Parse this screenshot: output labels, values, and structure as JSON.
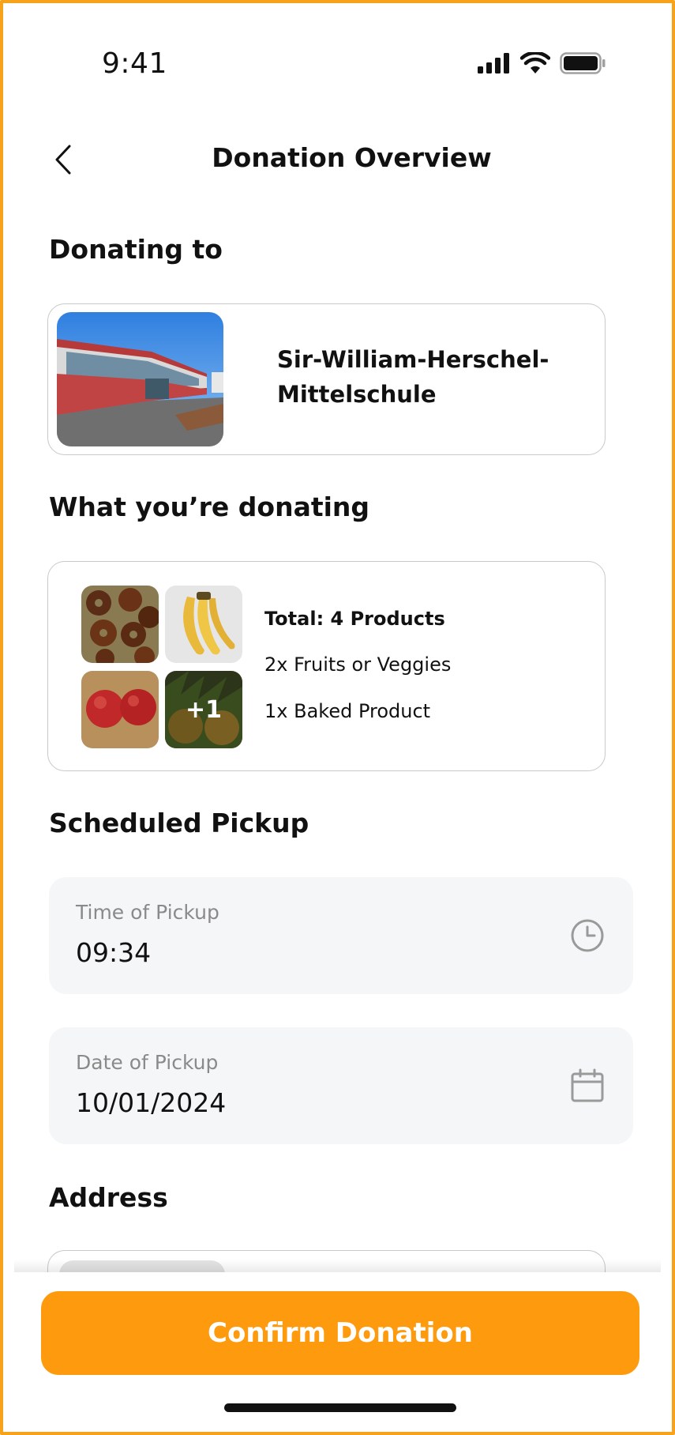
{
  "status_bar": {
    "time": "9:41"
  },
  "header": {
    "title": "Donation Overview"
  },
  "recipient": {
    "heading": "Donating to",
    "name": "Sir-William-Herschel-Mittelschule"
  },
  "donation": {
    "heading": "What you’re donating",
    "more_badge": "+1",
    "total": "Total: 4 Products",
    "lines": [
      "2x Fruits or Veggies",
      "1x Baked Product"
    ]
  },
  "pickup": {
    "heading": "Scheduled Pickup",
    "time": {
      "label": "Time of Pickup",
      "value": "09:34",
      "icon": "clock-icon"
    },
    "date": {
      "label": "Date of Pickup",
      "value": "10/01/2024",
      "icon": "calendar-icon"
    }
  },
  "address": {
    "heading": "Address"
  },
  "actions": {
    "confirm_label": "Confirm Donation"
  },
  "colors": {
    "accent": "#fd9a0d",
    "frame": "#f7a21b",
    "field_bg": "#f4f6f7"
  }
}
